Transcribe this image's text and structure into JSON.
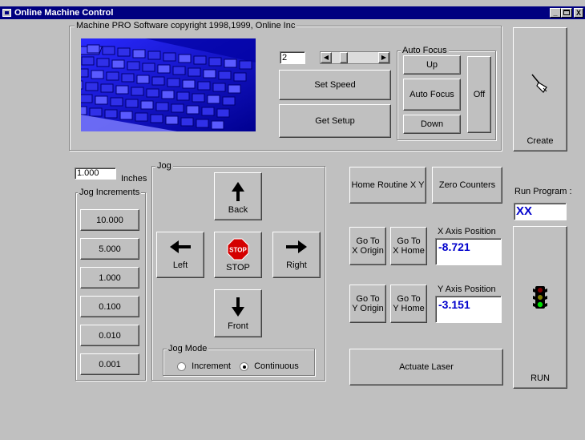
{
  "window": {
    "title": "Online Machine Control",
    "controls": [
      "_",
      " ",
      "X"
    ]
  },
  "top_panel": {
    "label": "Machine PRO Software   copyright 1998,1999, Online Inc"
  },
  "speed": {
    "value": "2",
    "set_speed_label": "Set Speed",
    "get_setup_label": "Get Setup",
    "slider_fraction": 0.2
  },
  "auto_focus": {
    "label": "Auto Focus",
    "up": "Up",
    "auto": "Auto Focus",
    "down": "Down",
    "off": "Off"
  },
  "create": {
    "label": "Create"
  },
  "inches": {
    "value": "1.000",
    "unit": "Inches"
  },
  "jog_increments": {
    "label": "Jog Increments",
    "items": [
      "10.000",
      "5.000",
      "1.000",
      "0.100",
      "0.010",
      "0.001"
    ]
  },
  "jog": {
    "label": "Jog",
    "back": "Back",
    "left": "Left",
    "stop": "STOP",
    "stop_sign": "STOP",
    "right": "Right",
    "front": "Front",
    "mode_label": "Jog Mode",
    "increment": "Increment",
    "continuous": "Continuous"
  },
  "home": {
    "routine": "Home Routine X Y",
    "zero": "Zero  Counters"
  },
  "x_axis": {
    "go_origin_l1": "Go To",
    "go_origin_l2": "X Origin",
    "go_home_l1": "Go To",
    "go_home_l2": "X Home",
    "label": "X Axis Position",
    "value": "-8.721"
  },
  "y_axis": {
    "go_origin_l1": "Go To",
    "go_origin_l2": "Y Origin",
    "go_home_l1": "Go To",
    "go_home_l2": "Y Home",
    "label": "Y Axis Position",
    "value": "-3.151"
  },
  "laser": {
    "label": "Actuate    Laser"
  },
  "run_program": {
    "label": "Run Program :",
    "value": "XX",
    "run": "RUN"
  },
  "colors": {
    "title_bar": "#000080",
    "face": "#c0c0c0",
    "value_blue": "#0000cc",
    "stop_red": "#d40000"
  }
}
